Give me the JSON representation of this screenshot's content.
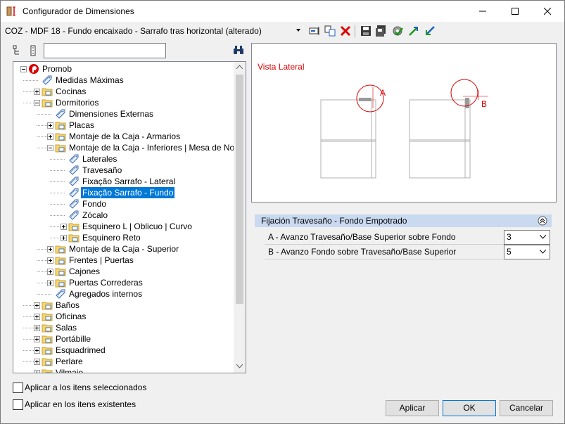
{
  "window": {
    "title": "Configurador de Dimensiones",
    "minimize_glyph": "—",
    "maximize_glyph": "☐",
    "close_glyph": "✕"
  },
  "toolbar": {
    "combo_value": "COZ - MDF 18 - Fundo encaixado - Sarrafo tras horizontal (alterado)",
    "icons": [
      "rename-icon",
      "copy-icon",
      "delete-icon",
      "save-icon",
      "save-as-icon",
      "check-gear-icon",
      "export-icon",
      "import-icon"
    ]
  },
  "search": {
    "value": "",
    "placeholder": ""
  },
  "tree": {
    "items": [
      {
        "label": "Promob",
        "level": 0,
        "icon": "promob-logo",
        "expander": "minus"
      },
      {
        "label": "Medidas Máximas",
        "level": 1,
        "icon": "tag",
        "expander": "none"
      },
      {
        "label": "Cocinas",
        "level": 1,
        "icon": "folder",
        "expander": "plus"
      },
      {
        "label": "Dormitorios",
        "level": 1,
        "icon": "folder",
        "expander": "minus"
      },
      {
        "label": "Dimensiones Externas",
        "level": 2,
        "icon": "tag",
        "expander": "none"
      },
      {
        "label": "Placas",
        "level": 2,
        "icon": "folder",
        "expander": "plus"
      },
      {
        "label": "Montaje de la Caja - Armarios",
        "level": 2,
        "icon": "folder",
        "expander": "plus"
      },
      {
        "label": "Montaje de la Caja - Inferiores | Mesa de Noche",
        "level": 2,
        "icon": "folder",
        "expander": "minus"
      },
      {
        "label": "Laterales",
        "level": 3,
        "icon": "tag",
        "expander": "none"
      },
      {
        "label": "Travesaño",
        "level": 3,
        "icon": "tag",
        "expander": "none"
      },
      {
        "label": "Fixação Sarrafo - Lateral",
        "level": 3,
        "icon": "tag",
        "expander": "none"
      },
      {
        "label": "Fixação Sarrafo - Fundo",
        "level": 3,
        "icon": "tag",
        "expander": "none",
        "selected": true
      },
      {
        "label": "Fondo",
        "level": 3,
        "icon": "tag",
        "expander": "none"
      },
      {
        "label": "Zócalo",
        "level": 3,
        "icon": "tag",
        "expander": "none"
      },
      {
        "label": "Esquinero L | Oblicuo | Curvo",
        "level": 3,
        "icon": "folder",
        "expander": "plus"
      },
      {
        "label": "Esquinero Reto",
        "level": 3,
        "icon": "folder",
        "expander": "plus"
      },
      {
        "label": "Montaje de la Caja - Superior",
        "level": 2,
        "icon": "folder",
        "expander": "plus"
      },
      {
        "label": "Frentes | Puertas",
        "level": 2,
        "icon": "folder",
        "expander": "plus"
      },
      {
        "label": "Cajones",
        "level": 2,
        "icon": "folder",
        "expander": "plus"
      },
      {
        "label": "Puertas Correderas",
        "level": 2,
        "icon": "folder",
        "expander": "plus"
      },
      {
        "label": "Agregados internos",
        "level": 2,
        "icon": "tag",
        "expander": "none"
      },
      {
        "label": "Baños",
        "level": 1,
        "icon": "folder",
        "expander": "plus"
      },
      {
        "label": "Oficinas",
        "level": 1,
        "icon": "folder",
        "expander": "plus"
      },
      {
        "label": "Salas",
        "level": 1,
        "icon": "folder",
        "expander": "plus"
      },
      {
        "label": "Portábille",
        "level": 1,
        "icon": "folder",
        "expander": "plus"
      },
      {
        "label": "Esquadrimed",
        "level": 1,
        "icon": "folder",
        "expander": "plus"
      },
      {
        "label": "Perlare",
        "level": 1,
        "icon": "folder",
        "expander": "plus"
      },
      {
        "label": "Vilmaio",
        "level": 1,
        "icon": "folder",
        "expander": "plus"
      }
    ]
  },
  "preview": {
    "label": "Vista Lateral",
    "marker_a": "A",
    "marker_b": "B",
    "accent": "#d90000"
  },
  "properties": {
    "section_title": "Fijación Travesaño - Fondo Empotrado",
    "rows": [
      {
        "label": "A - Avanzo Travesaño/Base Superior sobre Fondo",
        "value": "3"
      },
      {
        "label": "B - Avanzo Fondo sobre Travesaño/Base Superior",
        "value": "5"
      }
    ]
  },
  "options": {
    "apply_selected": "Aplicar a los itens seleccionados",
    "apply_existing": "Aplicar en los itens existentes"
  },
  "buttons": {
    "apply": "Aplicar",
    "ok": "OK",
    "cancel": "Cancelar"
  },
  "colors": {
    "selection": "#0078d7",
    "section_header": "#c9daf0"
  }
}
